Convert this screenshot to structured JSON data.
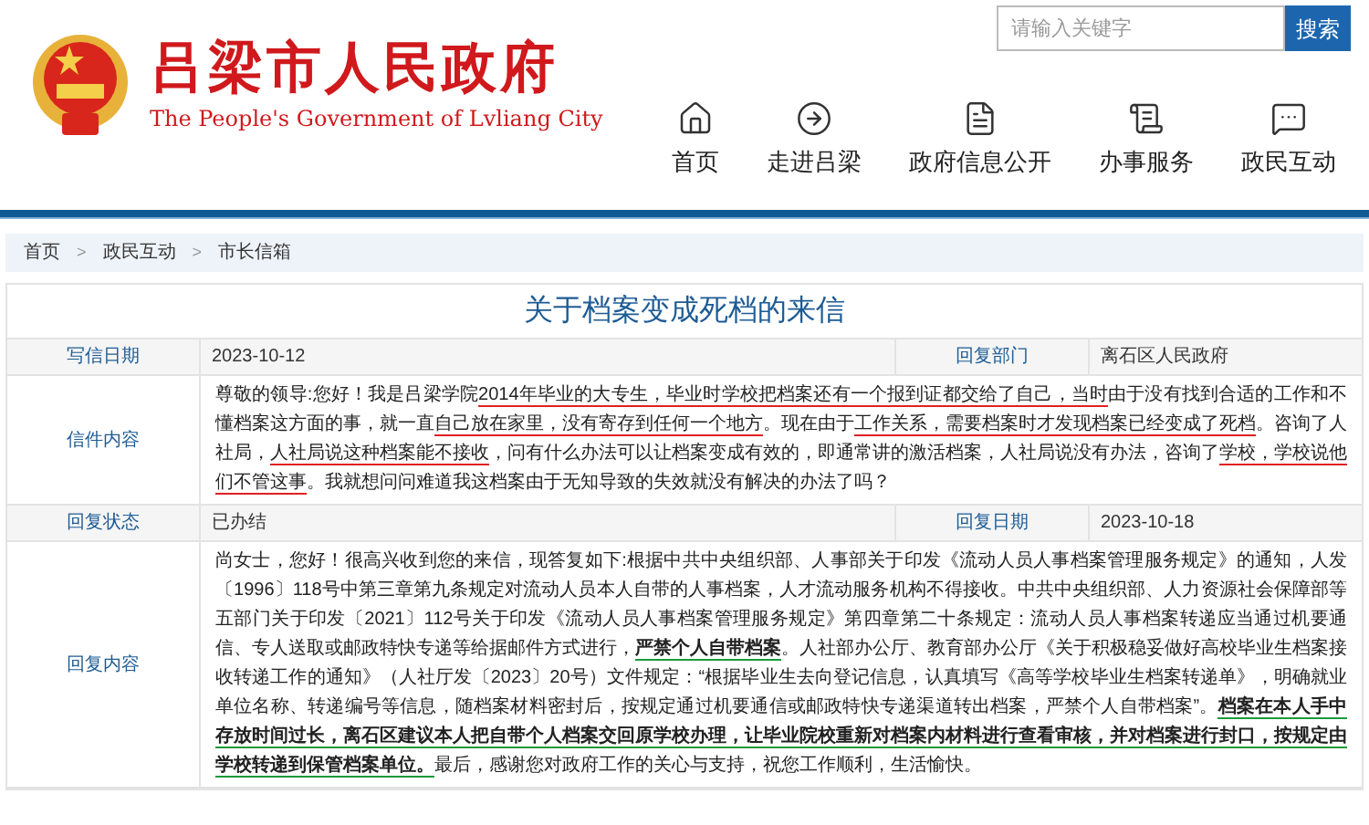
{
  "header": {
    "title": "吕梁市人民政府",
    "subtitle": "The People's Government of Lvliang City",
    "search": {
      "placeholder": "请输入关键字",
      "button": "搜索"
    },
    "nav": [
      {
        "kind": "home",
        "label": "首页"
      },
      {
        "kind": "enter",
        "label": "走进吕梁"
      },
      {
        "kind": "doc",
        "label": "政府信息公开"
      },
      {
        "kind": "list",
        "label": "办事服务"
      },
      {
        "kind": "chat",
        "label": "政民互动"
      }
    ]
  },
  "breadcrumb": {
    "separator": ">",
    "items": [
      "首页",
      "政民互动",
      "市长信箱"
    ]
  },
  "letter": {
    "title": "关于档案变成死档的来信",
    "rows": [
      {
        "kind": "pair",
        "label": "写信日期",
        "value": "2023-10-12",
        "label_2": "回复部门",
        "value_2": "离石区人民政府"
      },
      {
        "kind": "text",
        "label": "信件内容",
        "segments": [
          {
            "text": "尊敬的领导:您好！我是吕梁学院",
            "bold": false
          },
          {
            "text": "2014年毕业的大专生，毕业时学校把档案还有一个报到证都交给了自己，当时",
            "bold": false,
            "color": "#e02020"
          },
          {
            "text": "由于没有找到合适的工作和不懂档案这方面的事，就一直",
            "bold": false
          },
          {
            "text": "自己放在家里，没有寄存到任何一个地方",
            "bold": false,
            "color": "#e02020"
          },
          {
            "text": "。现在由于",
            "bold": false
          },
          {
            "text": "工作关系，需要档案时才发现档案已经变成了死档",
            "bold": false,
            "color": "#e02020"
          },
          {
            "text": "。咨询了人社局，",
            "bold": false
          },
          {
            "text": "人社局说这种档案能不接收",
            "bold": false,
            "color": "#e02020"
          },
          {
            "text": "，问有什么办法可以让档案变成有效的，即通常讲的激活档案，人社局说没有办法，咨询了",
            "bold": false
          },
          {
            "text": "学校，学校说他们不管这事",
            "bold": false,
            "color": "#e02020"
          },
          {
            "text": "。我就想问问难道我这档案由于无知导致的失效就没有解决的办法了吗？",
            "bold": false
          }
        ]
      },
      {
        "kind": "pair",
        "label": "回复状态",
        "value": "已办结",
        "label_2": "回复日期",
        "value_2": "2023-10-18"
      },
      {
        "kind": "text",
        "label": "回复内容",
        "segments": [
          {
            "text": "尚女士，您好！很高兴收到您的来信，现答复如下:根据中共中央组织部、人事部关于印发《流动人员人事档案管理服务规定》的通知，人发〔1996〕118号中第三章第九条规定对流动人员本人自带的人事档案，人才流动服务机构不得接收。中共中央组织部、人力资源社会保障部等五部门关于印发〔2021〕112号关于印发《流动人员人事档案管理服务规定》第四章第二十条规定：流动人员人事档案转递应当通过机要通信、专人送取或邮政特快专递等给据邮件方式进行，",
            "bold": false
          },
          {
            "text": "严禁个人自带档案",
            "bold": true,
            "color": "#1a9a3a"
          },
          {
            "text": "。人社部办公厅、教育部办公厅《关于积极稳妥做好高校毕业生档案接收转递工作的通知》（人社厅发〔2023〕20号）文件规定：“根据毕业生去向登记信息，认真填写《高等学校毕业生档案转递单》，明确就业单位名称、转递编号等信息，随档案材料密封后，按规定通过机要通信或邮政特快专递渠道转出档案，严禁个人自带档案”。",
            "bold": false
          },
          {
            "text": "档案在本人手中存放时间过长，离石区建议本人把自带个人档案交回原学校办理，让毕业院校重新对档案内材料进行查看审核，并对档案进行封口，按规定由学校转递到保管档案单位。",
            "bold": true,
            "color": "#1a9a3a"
          },
          {
            "text": "最后，感谢您对政府工作的关心与支持，祝您工作顺利，生活愉快。",
            "bold": false
          }
        ]
      }
    ]
  }
}
